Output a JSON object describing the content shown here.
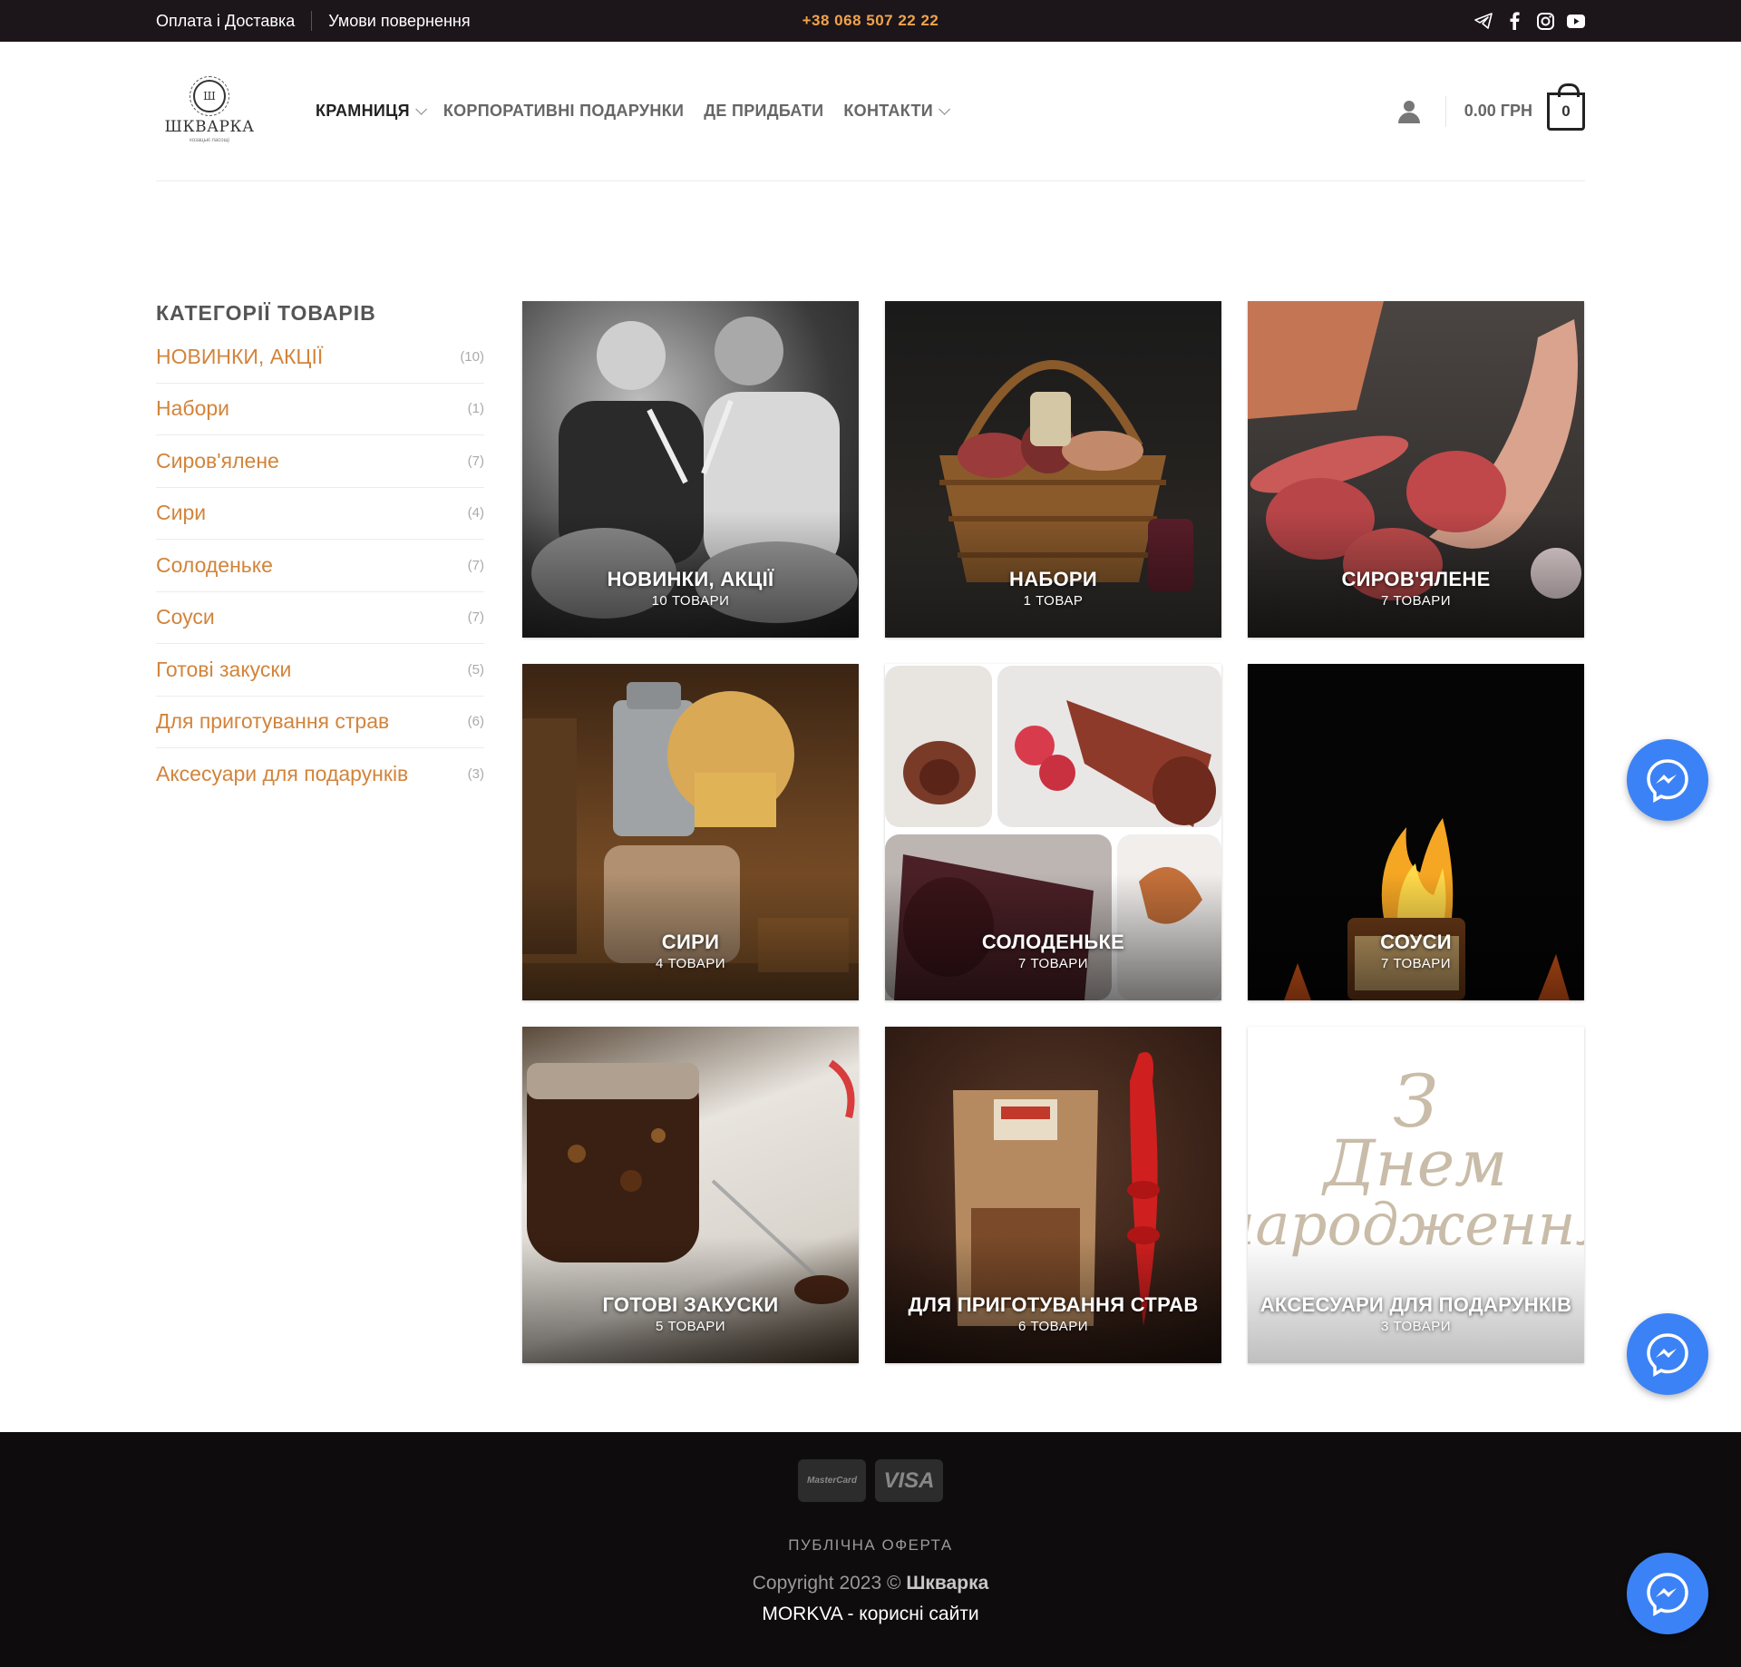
{
  "topbar": {
    "link_payment": "Оплата і Доставка",
    "link_returns": "Умови повернення",
    "phone": "+38 068 507 22 22",
    "social_icons": [
      "telegram-icon",
      "facebook-icon",
      "instagram-icon",
      "youtube-icon"
    ]
  },
  "header": {
    "logo_name": "ШКВАРКА",
    "logo_tag": "козацькі ласощі",
    "nav": [
      {
        "label": "Крамниця",
        "dropdown": true,
        "active": true
      },
      {
        "label": "Корпоративні подарунки",
        "dropdown": false
      },
      {
        "label": "Де придбати",
        "dropdown": false
      },
      {
        "label": "Контакти",
        "dropdown": true
      }
    ],
    "cart_total": "0.00 ГРН",
    "cart_count": "0"
  },
  "sidebar": {
    "title": "Категорії товарів",
    "categories": [
      {
        "label": "НОВИНКИ, АКЦІЇ",
        "count": "(10)"
      },
      {
        "label": "Набори",
        "count": "(1)"
      },
      {
        "label": "Сиров'ялене",
        "count": "(7)"
      },
      {
        "label": "Сири",
        "count": "(4)"
      },
      {
        "label": "Солоденьке",
        "count": "(7)"
      },
      {
        "label": "Соуси",
        "count": "(7)"
      },
      {
        "label": "Готові закуски",
        "count": "(5)"
      },
      {
        "label": "Для приготування страв",
        "count": "(6)"
      },
      {
        "label": "Аксесуари для подарунків",
        "count": "(3)"
      }
    ]
  },
  "tiles": [
    {
      "title": "НОВИНКИ, АКЦІЇ",
      "count": "10 ТОВАРИ"
    },
    {
      "title": "Набори",
      "count": "1 ТОВАР"
    },
    {
      "title": "Сиров'ялене",
      "count": "7 ТОВАРИ"
    },
    {
      "title": "Сири",
      "count": "4 ТОВАРИ"
    },
    {
      "title": "Солоденьке",
      "count": "7 ТОВАРИ"
    },
    {
      "title": "Соуси",
      "count": "7 ТОВАРИ"
    },
    {
      "title": "Готові закуски",
      "count": "5 ТОВАРИ"
    },
    {
      "title": "Для приготування страв",
      "count": "6 ТОВАРИ"
    },
    {
      "title": "Аксесуари для подарунків",
      "count": "3 ТОВАРИ"
    }
  ],
  "footer": {
    "pay_mastercard": "MasterCard",
    "pay_visa": "VISA",
    "offer": "Публічна оферта",
    "copyright_prefix": "Copyright 2023 ©",
    "copyright_brand": "Шкварка",
    "morkva": "MORKVA - корисні сайти"
  },
  "colors": {
    "accent": "#d2843b",
    "phone": "#f0a34a",
    "topbar_bg": "#1c151a",
    "footer_bg": "#0e0c0d",
    "messenger": "#3b82f6"
  }
}
